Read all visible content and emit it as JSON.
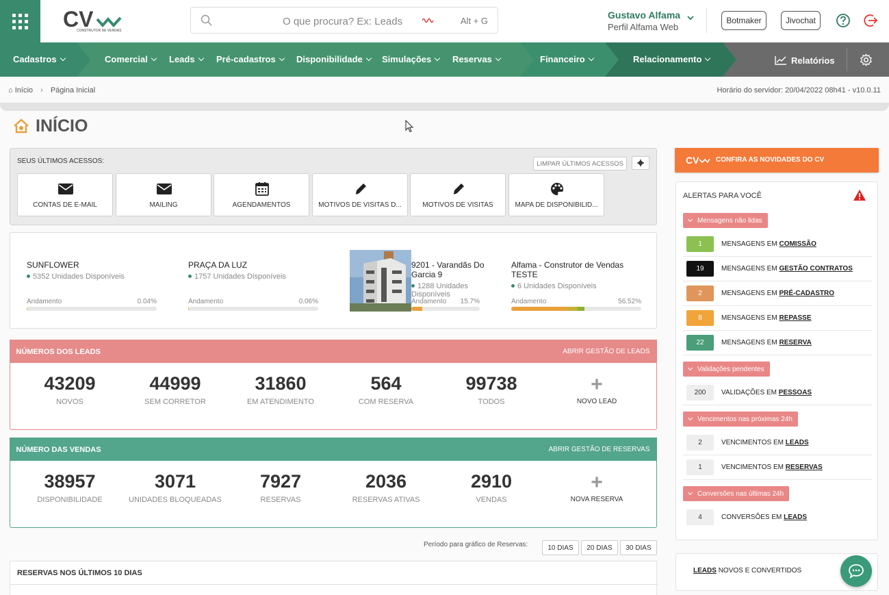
{
  "header": {
    "search_placeholder": "O que procura? Ex: Leads",
    "search_shortcut": "Alt + G",
    "user_name": "Gustavo Alfama",
    "user_profile": "Perfil Alfama Web",
    "botmaker": "Botmaker",
    "jivochat": "Jivochat",
    "logo_text": "CONSTRUTOR DE VENDAS"
  },
  "nav": {
    "cadastros": "Cadastros",
    "comercial": "Comercial",
    "leads": "Leads",
    "pre_cadastros": "Pré-cadastros",
    "disponibilidade": "Disponibilidade",
    "simulacoes": "Simulações",
    "reservas": "Reservas",
    "financeiro": "Financeiro",
    "relacionamento": "Relacionamento",
    "relatorios": "Relatórios"
  },
  "breadcrumb": {
    "home": "Início",
    "current": "Página Inicial",
    "server_time": "Horário do servidor: 20/04/2022 08h41 - v10.0.11"
  },
  "page_title": "INÍCIO",
  "last_access": {
    "heading": "SEUS ÚLTIMOS ACESSOS:",
    "clear": "LIMPAR ÚLTIMOS ACESSOS",
    "tiles": [
      {
        "label": "CONTAS DE E-MAIL",
        "icon": "envelope-icon"
      },
      {
        "label": "MAILING",
        "icon": "envelope-icon"
      },
      {
        "label": "AGENDAMENTOS",
        "icon": "calendar-icon"
      },
      {
        "label": "MOTIVOS DE VISITAS D...",
        "icon": "pencil-icon"
      },
      {
        "label": "MOTIVOS DE VISITAS",
        "icon": "pencil-icon"
      },
      {
        "label": "MAPA DE DISPONIBILID...",
        "icon": "palette-icon"
      }
    ]
  },
  "projects": [
    {
      "name": "SUNFLOWER",
      "units": "5352 Unidades Disponíveis",
      "progress_label": "Andamento",
      "progress_text": "0.04%",
      "progress": 0.04
    },
    {
      "name": "PRAÇA DA LUZ",
      "units": "1757 Unidades Disponíveis",
      "progress_label": "Andamento",
      "progress_text": "0.06%",
      "progress": 0.06
    },
    {
      "name": "9201 - Varandãs Do Garcia 9",
      "units": "1288 Unidades Disponíveis",
      "progress_label": "Andamento",
      "progress_text": "15.7%",
      "progress": 15.7
    },
    {
      "name": "Alfama - Construtor de Vendas TESTE",
      "units": "6 Unidades Disponíveis",
      "progress_label": "Andamento",
      "progress_text": "56.52%",
      "progress": 56.52
    }
  ],
  "leads_stats": {
    "title": "NÚMEROS DOS LEADS",
    "link": "ABRIR GESTÃO DE LEADS",
    "color": "#e68a8a",
    "items": [
      {
        "value": "43209",
        "label": "NOVOS"
      },
      {
        "value": "44999",
        "label": "SEM CORRETOR"
      },
      {
        "value": "31860",
        "label": "EM ATENDIMENTO"
      },
      {
        "value": "564",
        "label": "COM RESERVA"
      },
      {
        "value": "99738",
        "label": "TODOS"
      }
    ],
    "add_label": "NOVO LEAD"
  },
  "sales_stats": {
    "title": "NÚMERO DAS VENDAS",
    "link": "ABRIR GESTÃO DE RESERVAS",
    "color": "#53a58b",
    "items": [
      {
        "value": "38957",
        "label": "DISPONIBILIDADE"
      },
      {
        "value": "3071",
        "label": "UNIDADES BLOQUEADAS"
      },
      {
        "value": "7927",
        "label": "RESERVAS"
      },
      {
        "value": "2036",
        "label": "RESERVAS ATIVAS"
      },
      {
        "value": "2910",
        "label": "VENDAS"
      }
    ],
    "add_label": "NOVA RESERVA"
  },
  "period": {
    "label": "Período para gráfico de Reservas:",
    "options": [
      "10 DIAS",
      "20 DIAS",
      "30 DIAS"
    ]
  },
  "reservations_chart_title": "RESERVAS NOS ÚLTIMOS 10 DIAS",
  "news": "CONFIRA AS NOVIDADES DO CV",
  "alerts": {
    "title": "ALERTAS PARA VOCÊ",
    "sections": [
      {
        "title": "Mensagens não lidas",
        "rows": [
          {
            "count": "1",
            "prefix": "MENSAGENS EM",
            "link": "COMISSÃO",
            "color": "#8cc152"
          },
          {
            "count": "19",
            "prefix": "MENSAGENS EM",
            "link": "GESTÃO CONTRATOS",
            "color": "#111111"
          },
          {
            "count": "2",
            "prefix": "MENSAGENS EM",
            "link": "PRÉ-CADASTRO",
            "color": "#e0955a"
          },
          {
            "count": "8",
            "prefix": "MENSAGENS EM",
            "link": "REPASSE",
            "color": "#f0a43a"
          },
          {
            "count": "22",
            "prefix": "MENSAGENS EM",
            "link": "RESERVA",
            "color": "#4a9e7a"
          }
        ]
      },
      {
        "title": "Validações pendentes",
        "rows": [
          {
            "count": "200",
            "prefix": "VALIDAÇÕES EM",
            "link": "PESSOAS",
            "color": "#eeeeee"
          }
        ]
      },
      {
        "title": "Vencimentos nas próximas 24h",
        "rows": [
          {
            "count": "2",
            "prefix": "VENCIMENTOS EM",
            "link": "LEADS",
            "color": "#eeeeee"
          },
          {
            "count": "1",
            "prefix": "VENCIMENTOS EM",
            "link": "RESERVAS",
            "color": "#eeeeee"
          }
        ]
      },
      {
        "title": "Conversões nas últimas 24h",
        "rows": [
          {
            "count": "4",
            "prefix": "CONVERSÕES EM",
            "link": "LEADS",
            "color": "#eeeeee"
          }
        ]
      }
    ]
  },
  "leads_box": {
    "link": "LEADS",
    "text": "NOVOS E CONVERTIDOS"
  }
}
